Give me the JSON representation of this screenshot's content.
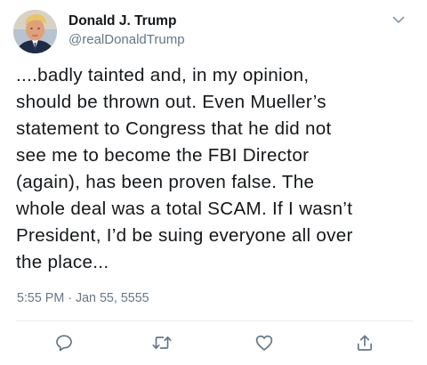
{
  "tweet": {
    "display_name": "Donald J. Trump",
    "handle": "@realDonaldTrump",
    "text": "....badly tainted and, in my opinion,\nshould be thrown out. Even Mueller’s\nstatement to Congress that he did not\nsee me to become the FBI Director\n(again), has been proven false. The\nwhole deal was a total SCAM. If I wasn’t\nPresident, I’d be suing everyone all over\nthe place...",
    "timestamp": "5:55 PM · Jan 55, 5555"
  },
  "icons": {
    "caret": "chevron-down-icon",
    "reply": "reply-icon",
    "retweet": "retweet-icon",
    "like": "heart-icon",
    "share": "share-icon"
  },
  "colors": {
    "text": "#14171a",
    "secondary": "#657786",
    "icon": "#657786",
    "divider": "#e6ecf0"
  }
}
